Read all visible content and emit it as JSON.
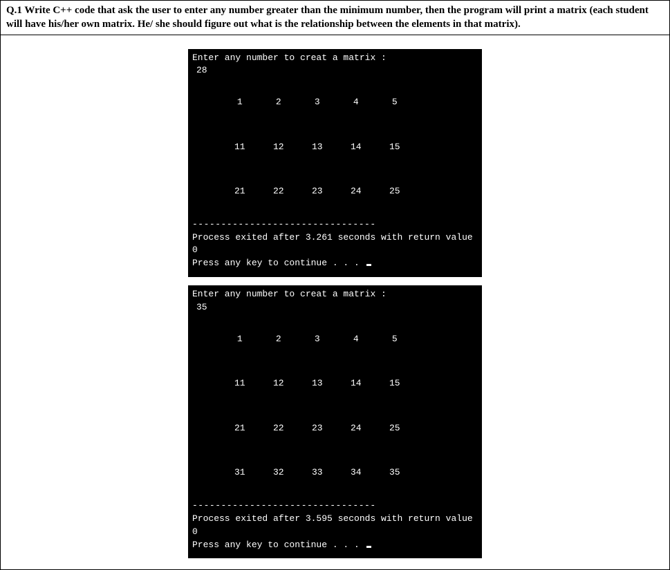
{
  "question": {
    "text": "Q.1 Write C++ code that ask the user to enter any number greater than the minimum number, then the program will print a matrix (each student will have his/her own matrix. He/ she should figure out what is the relationship between the elements in that matrix)."
  },
  "console1": {
    "prompt": "Enter any number to creat a matrix :",
    "input": "28",
    "matrix": [
      [
        "1",
        "2",
        "3",
        "4",
        "5"
      ],
      [
        "11",
        "12",
        "13",
        "14",
        "15"
      ],
      [
        "21",
        "22",
        "23",
        "24",
        "25"
      ]
    ],
    "divider": "--------------------------------",
    "exit": "Process exited after 3.261 seconds with return value 0",
    "continue": "Press any key to continue . . . "
  },
  "console2": {
    "prompt": "Enter any number to creat a matrix :",
    "input": "35",
    "matrix": [
      [
        "1",
        "2",
        "3",
        "4",
        "5"
      ],
      [
        "11",
        "12",
        "13",
        "14",
        "15"
      ],
      [
        "21",
        "22",
        "23",
        "24",
        "25"
      ],
      [
        "31",
        "32",
        "33",
        "34",
        "35"
      ]
    ],
    "divider": "--------------------------------",
    "exit": "Process exited after 3.595 seconds with return value 0",
    "continue": "Press any key to continue . . . "
  }
}
